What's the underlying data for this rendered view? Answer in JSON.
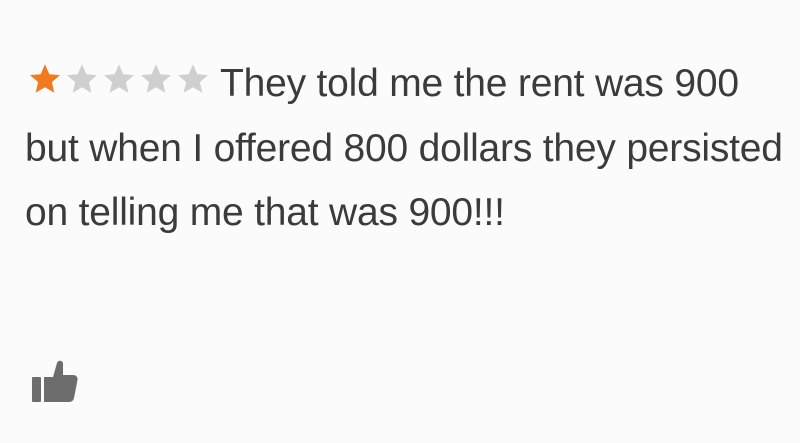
{
  "review": {
    "rating": 1,
    "max_rating": 5,
    "text": "They told me the rent was 900 but when I offered 800 dollars they persisted on telling me that was 900!!!"
  },
  "colors": {
    "star_filled": "#f07a1f",
    "star_empty": "#cfcfcf",
    "text": "#3b3b3b",
    "thumb_icon": "#6d6d6d",
    "background": "#fbfbfb"
  },
  "icons": {
    "rating": "star-icon",
    "helpful": "thumbs-up-icon"
  }
}
